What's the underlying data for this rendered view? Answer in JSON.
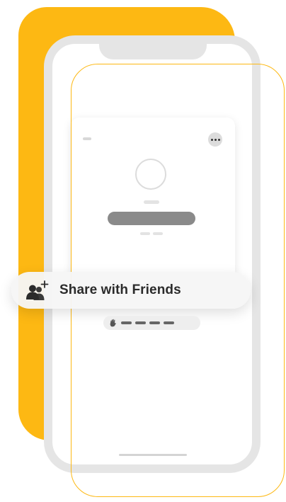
{
  "share": {
    "label": "Share with Friends",
    "icon": "add-person-icon"
  },
  "card": {
    "more_icon": "more-dots-icon",
    "avatar_icon": "avatar-circle-icon"
  },
  "token": {
    "icon": "hand-stop-icon",
    "dash_count": 4
  },
  "colors": {
    "accent": "#FDB813",
    "phone_frame": "#E5E5E5",
    "name_bar": "#8A8A8A",
    "label_text": "#2B2B2B"
  }
}
